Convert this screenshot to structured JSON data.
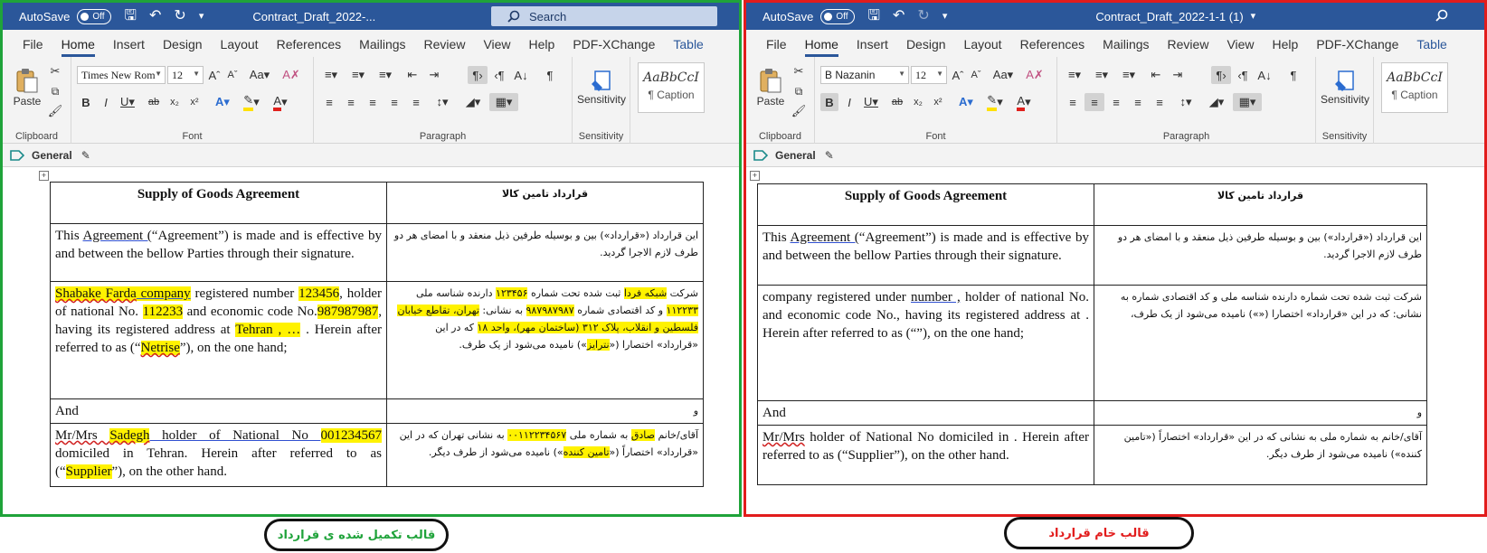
{
  "left": {
    "autosave_label": "AutoSave",
    "autosave_state": "Off",
    "doc_title": "Contract_Draft_2022-...",
    "search_placeholder": "Search",
    "tabs": [
      "File",
      "Home",
      "Insert",
      "Design",
      "Layout",
      "References",
      "Mailings",
      "Review",
      "View",
      "Help",
      "PDF-XChange",
      "Table"
    ],
    "active_tab": "Home",
    "font_name": "Times New Rom",
    "font_size": "12",
    "paste_label": "Paste",
    "sensitivity_label": "Sensitivity",
    "style_sample": "AaBbCcI",
    "style_name": "¶ Caption",
    "groups": {
      "clipboard": "Clipboard",
      "font": "Font",
      "paragraph": "Paragraph",
      "sensitivity": "Sensitivity"
    },
    "sensitivity_tag": "General",
    "table": {
      "title_en": "Supply of Goods Agreement",
      "title_fa": "قرارداد تامین کالا",
      "r1_en_a": "This ",
      "r1_en_link": "Agreement (",
      "r1_en_b": "“Agreement”) is made and is effective by and between the bellow Parties through their signature.",
      "r1_fa": "این قرارداد («قرارداد») بین و بوسیله طرفین ذیل منعقد و با امضای هر دو طرف لازم الاجرا گردید.",
      "r2_en": {
        "company": "Shabake Farda",
        "company_word": " company",
        "t1": " registered number ",
        "reg": "123456",
        "t2": ", holder of national No. ",
        "nat": "112233",
        "t3": " and economic code No.",
        "eco": "987987987",
        "t4": ", having its registered address at ",
        "city": "Tehran , …",
        "t5": " . Herein after referred to as (“",
        "alias": "Netrise",
        "t6": "”), on the one hand;"
      },
      "r2_fa": {
        "a": "شرکت ",
        "company": "شبکه فردا",
        "b": " ثبت شده تحت شماره ",
        "reg": "۱۲۳۴۵۶",
        "c": " دارنده شناسه ملی ",
        "nat": "۱۱۲۲۳۳",
        "d": " و کد اقتصادی شماره ",
        "eco": "۹۸۷۹۸۷۹۸۷",
        "e": " به نشانی: ",
        "addr": "تهران، تقاطع خیابان فلسطین و انقلاب، پلاک ۳۱۲ (ساختمان مهر)، واحد ۱۸",
        "f": " که در این «قرارداد» اختصارا («",
        "alias": "نترایز",
        "g": "») نامیده می‌شود از یک طرف."
      },
      "r3_en": "And",
      "r3_fa": "و",
      "r4_en": {
        "a": "Mr/Mrs ",
        "name": "Sadegh",
        "b": "  holder of National No ",
        "nat": "001234567",
        "c": " domiciled in    Tehran. Herein after referred to as (“",
        "alias": "Supplier",
        "d": "”), on the other hand."
      },
      "r4_fa": {
        "a": "آقای/خانم ",
        "name": "صادق",
        "b": " به شماره ملی ",
        "nat": "۰۰۱۱۲۲۳۴۵۶۷",
        "c": " به نشانی تهران که در این «قرارداد» اختصاراً («",
        "alias": "تامین کننده",
        "d": "») نامیده می‌شود از طرف دیگر."
      }
    }
  },
  "right": {
    "autosave_label": "AutoSave",
    "autosave_state": "Off",
    "doc_title": "Contract_Draft_2022-1-1 (1)",
    "tabs": [
      "File",
      "Home",
      "Insert",
      "Design",
      "Layout",
      "References",
      "Mailings",
      "Review",
      "View",
      "Help",
      "PDF-XChange",
      "Table"
    ],
    "active_tab": "Home",
    "font_name": "B Nazanin",
    "font_size": "12",
    "paste_label": "Paste",
    "sensitivity_label": "Sensitivity",
    "style_sample": "AaBbCcI",
    "style_name": "¶ Caption",
    "groups": {
      "clipboard": "Clipboard",
      "font": "Font",
      "paragraph": "Paragraph",
      "sensitivity": "Sensitivity"
    },
    "sensitivity_tag": "General",
    "table": {
      "title_en": "Supply of Goods Agreement",
      "title_fa": "قرارداد تامین کالا",
      "r1_en_a": "This ",
      "r1_en_link": "Agreement (",
      "r1_en_b": "“Agreement”) is made and is effective by and between the bellow Parties through their signature.",
      "r1_fa": "این قرارداد («قرارداد») بین و بوسیله طرفین ذیل منعقد و با امضای هر دو طرف لازم الاجرا گردید.",
      "r2_en_a": "  company registered under ",
      "r2_en_link": "number ,",
      "r2_en_b": " holder of national No. and economic code No., having its registered address at . Herein after referred to as (“”), on the one hand;",
      "r2_fa": "شرکت  ثبت شده تحت شماره  دارنده شناسه ملی  و کد اقتصادی شماره  به نشانی:   که در این «قرارداد» اختصارا («») نامیده می‌شود از یک طرف،",
      "r3_en": "And",
      "r3_fa": "و",
      "r4_en_a": "Mr/Mrs",
      "r4_en_b": " holder of National No  domiciled in   . Herein after referred to as (“Supplier”), on the other hand.",
      "r4_fa": "آقای/خانم  به شماره ملی  به نشانی  که در این «قرارداد» اختصاراً («تامین کننده») نامیده می‌شود از طرف دیگر."
    }
  },
  "captions": {
    "left": "قالب تکمیل شده ی قرارداد",
    "left_color": "#1fa33a",
    "right": "قالب خام قرارداد",
    "right_color": "#e21c1c"
  },
  "colors": {
    "titlebar": "#2b579a",
    "highlight": "#fff200",
    "left_frame": "#1fa33a",
    "right_frame": "#e21c1c"
  }
}
